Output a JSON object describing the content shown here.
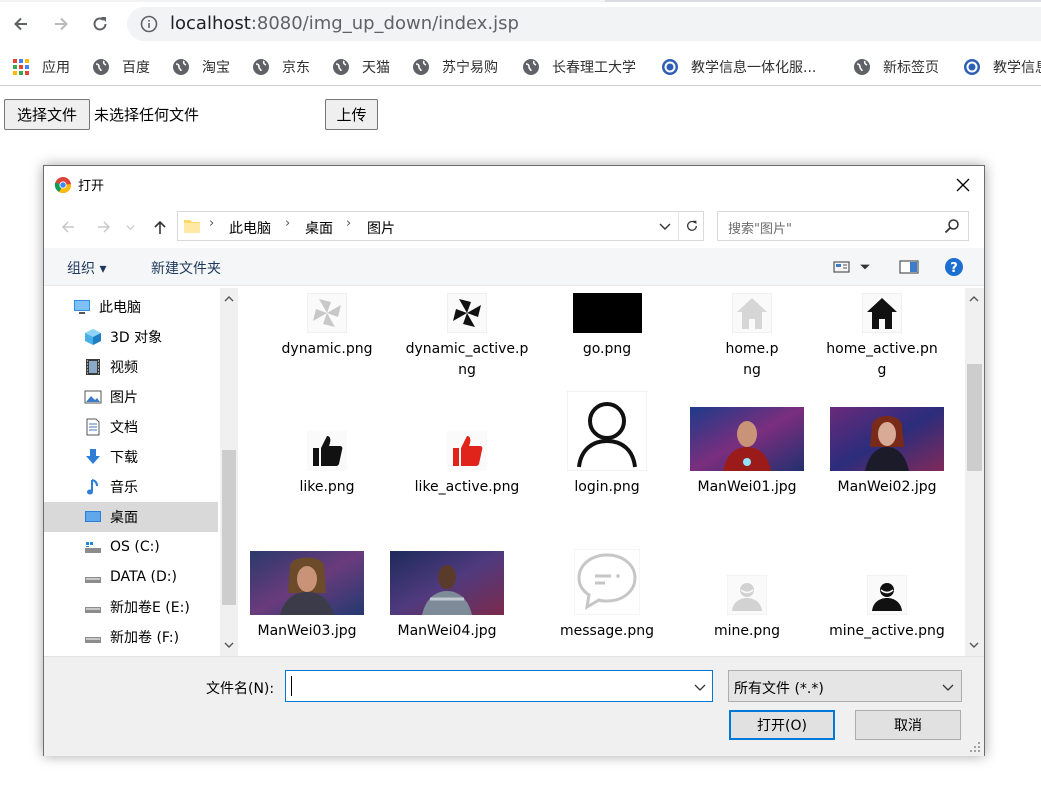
{
  "browser": {
    "url_host": "localhost",
    "url_rest": ":8080/img_up_down/index.jsp",
    "bookmarks": [
      {
        "label": "应用",
        "icon": "apps-grid-icon"
      },
      {
        "label": "百度",
        "icon": "globe-icon"
      },
      {
        "label": "淘宝",
        "icon": "globe-icon"
      },
      {
        "label": "京东",
        "icon": "globe-icon"
      },
      {
        "label": "天猫",
        "icon": "globe-icon"
      },
      {
        "label": "苏宁易购",
        "icon": "globe-icon"
      },
      {
        "label": "长春理工大学",
        "icon": "globe-icon"
      },
      {
        "label": "教学信息一体化服...",
        "icon": "university-seal-icon"
      },
      {
        "label": "新标签页",
        "icon": "globe-icon"
      },
      {
        "label": "教学信息",
        "icon": "university-seal-icon"
      }
    ]
  },
  "page": {
    "choose_file_label": "选择文件",
    "no_file_text": "未选择任何文件",
    "upload_label": "上传"
  },
  "dialog": {
    "title": "打开",
    "breadcrumb": [
      "此电脑",
      "桌面",
      "图片"
    ],
    "search_placeholder": "搜索\"图片\"",
    "toolbar": {
      "organize": "组织 ▾",
      "new_folder": "新建文件夹"
    },
    "nav_items": [
      {
        "label": "此电脑",
        "icon": "computer-icon",
        "level": 0
      },
      {
        "label": "3D 对象",
        "icon": "3d-objects-icon",
        "level": 1
      },
      {
        "label": "视频",
        "icon": "video-icon",
        "level": 1
      },
      {
        "label": "图片",
        "icon": "pictures-icon",
        "level": 1
      },
      {
        "label": "文档",
        "icon": "documents-icon",
        "level": 1
      },
      {
        "label": "下载",
        "icon": "download-icon",
        "level": 1
      },
      {
        "label": "音乐",
        "icon": "music-icon",
        "level": 1
      },
      {
        "label": "桌面",
        "icon": "desktop-icon",
        "level": 1,
        "selected": true
      },
      {
        "label": "OS (C:)",
        "icon": "os-drive-icon",
        "level": 1
      },
      {
        "label": "DATA (D:)",
        "icon": "drive-icon",
        "level": 1
      },
      {
        "label": "新加卷E (E:)",
        "icon": "drive-icon",
        "level": 1
      },
      {
        "label": "新加卷 (F:)",
        "icon": "drive-icon",
        "level": 1
      }
    ],
    "files": [
      {
        "name": "dynamic.png",
        "thumb": "pinwheel-gray"
      },
      {
        "name": "dynamic_active.png",
        "thumb": "pinwheel-black"
      },
      {
        "name": "go.png",
        "thumb": "black-rect"
      },
      {
        "name": "home.png",
        "thumb": "home-gray"
      },
      {
        "name": "home_active.png",
        "thumb": "home-black"
      },
      {
        "name": "like.png",
        "thumb": "thumb-black"
      },
      {
        "name": "like_active.png",
        "thumb": "thumb-red"
      },
      {
        "name": "login.png",
        "thumb": "user-outline"
      },
      {
        "name": "ManWei01.jpg",
        "thumb": "photo-1"
      },
      {
        "name": "ManWei02.jpg",
        "thumb": "photo-2"
      },
      {
        "name": "ManWei03.jpg",
        "thumb": "photo-3"
      },
      {
        "name": "ManWei04.jpg",
        "thumb": "photo-4"
      },
      {
        "name": "message.png",
        "thumb": "chat-bubble"
      },
      {
        "name": "mine.png",
        "thumb": "mine-gray"
      },
      {
        "name": "mine_active.png",
        "thumb": "mine-black"
      }
    ],
    "filename_label": "文件名(N):",
    "filename_value": "",
    "filetype_value": "所有文件 (*.*)",
    "open_label": "打开(O)",
    "cancel_label": "取消"
  }
}
